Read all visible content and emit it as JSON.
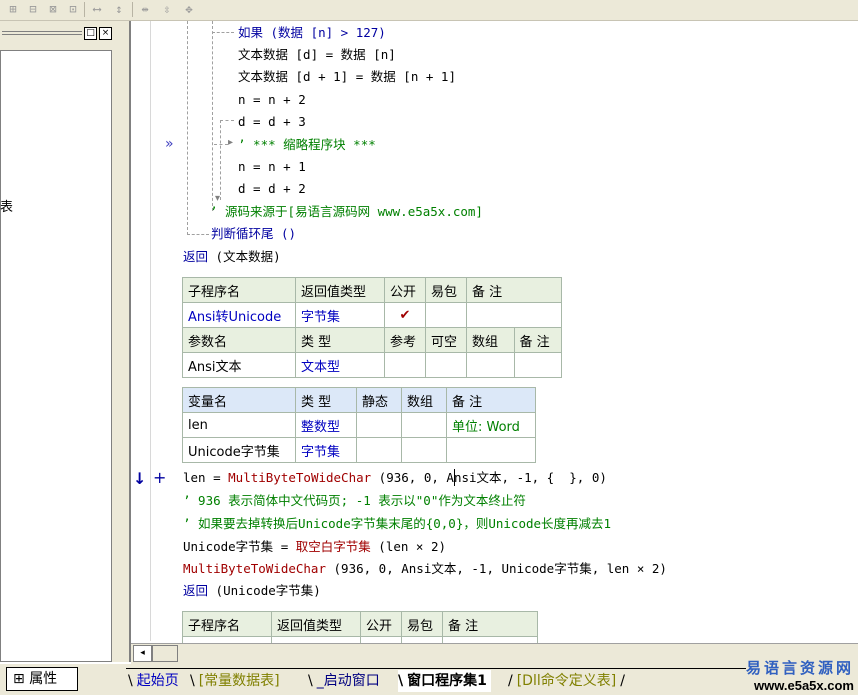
{
  "toolbar": {
    "icons": [
      "align-left-icon",
      "align-center-icon",
      "align-right-icon",
      "align-top-icon",
      "equal-width-icon",
      "equal-height-icon",
      "center-h-icon",
      "center-v-icon",
      "center-both-icon"
    ]
  },
  "panel": {
    "edge_label": "表",
    "btn_restore": "□",
    "btn_close": "×"
  },
  "code": {
    "l1": "如果 (数据 [n] > 127)",
    "l2": "文本数据 [d] = 数据 [n]",
    "l3": "文本数据 [d + 1] = 数据 [n + 1]",
    "l4": "n = n + 2",
    "l5": "d = d + 3",
    "l6": "’ *** 缩略程序块 ***",
    "l7": "n = n + 1",
    "l8": "d = d + 2",
    "l9": "’ 源码来源于[易语言源码网 www.e5a5x.com]",
    "l10": "判断循环尾 ()",
    "l11_kw": "返回",
    "l11_rest": " (文本数据)",
    "marker": "»",
    "l12_a": "len = ",
    "l12_fn": "MultiByteToWideChar",
    "l12_b": " (936, 0, Ansi文本, -1, {  }, 0)",
    "l13": "’ 936 表示简体中文代码页; -1 表示以\"0\"作为文本终止符",
    "l14": "’ 如果要去掉转换后Unicode字节集末尾的{0,0}，则Unicode长度再减去1",
    "l15_a": "Unicode字节集 = ",
    "l15_fn": "取空白字节集",
    "l15_b": " (len × 2)",
    "l16_fn": "MultiByteToWideChar",
    "l16_b": " (936, 0, Ansi文本, -1, Unicode字节集, len × 2)",
    "l17_kw": "返回",
    "l17_rest": " (Unicode字节集)",
    "arrow": "↓",
    "plus": "+"
  },
  "table1": {
    "h": [
      "子程序名",
      "返回值类型",
      "公开",
      "易包",
      "备 注"
    ],
    "r1": [
      "Ansi转Unicode",
      "字节集",
      "✔",
      "",
      ""
    ],
    "h2": [
      "参数名",
      "类 型",
      "参考",
      "可空",
      "数组",
      "备 注"
    ],
    "r2": [
      "Ansi文本",
      "文本型",
      "",
      "",
      "",
      ""
    ]
  },
  "table2": {
    "h": [
      "变量名",
      "类 型",
      "静态",
      "数组",
      "备 注"
    ],
    "r1": [
      "len",
      "整数型",
      "",
      "",
      "单位: Word"
    ],
    "r2": [
      "Unicode字节集",
      "字节集",
      "",
      "",
      ""
    ]
  },
  "table3": {
    "h": [
      "子程序名",
      "返回值类型",
      "公开",
      "易包",
      "备 注"
    ]
  },
  "scroll": {
    "left_arrow": "◂"
  },
  "tabs": {
    "props": "属性",
    "t1": "起始页",
    "t2": "[常量数据表]",
    "t3": "_启动窗口",
    "t4": "窗口程序集1",
    "t5": "[Dll命令定义表]"
  },
  "logo": {
    "line1": "易语言资源网",
    "line2": "www.e5a5x.com"
  }
}
